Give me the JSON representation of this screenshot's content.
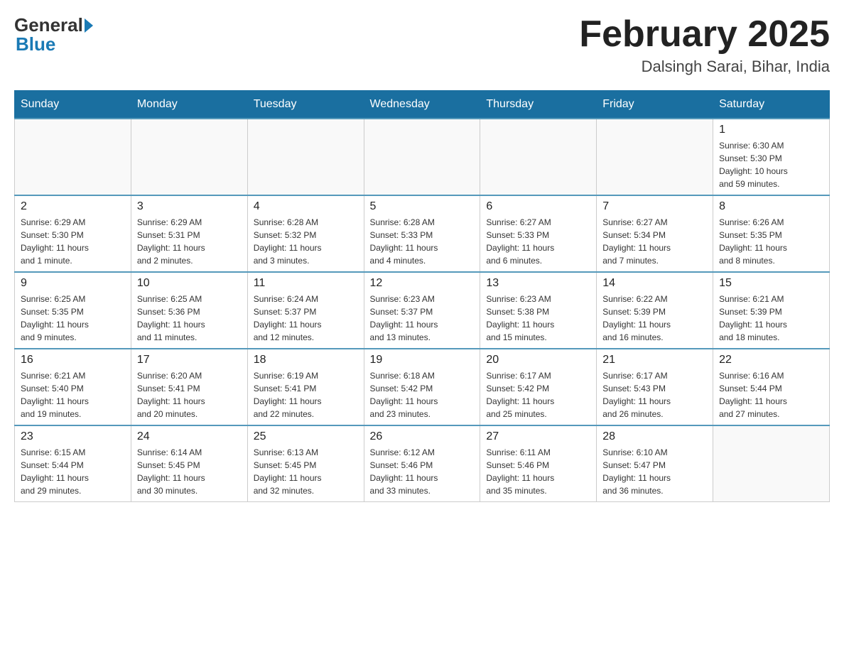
{
  "header": {
    "logo_general": "General",
    "logo_blue": "Blue",
    "month_title": "February 2025",
    "location": "Dalsingh Sarai, Bihar, India"
  },
  "weekdays": [
    "Sunday",
    "Monday",
    "Tuesday",
    "Wednesday",
    "Thursday",
    "Friday",
    "Saturday"
  ],
  "weeks": [
    [
      {
        "day": "",
        "info": ""
      },
      {
        "day": "",
        "info": ""
      },
      {
        "day": "",
        "info": ""
      },
      {
        "day": "",
        "info": ""
      },
      {
        "day": "",
        "info": ""
      },
      {
        "day": "",
        "info": ""
      },
      {
        "day": "1",
        "info": "Sunrise: 6:30 AM\nSunset: 5:30 PM\nDaylight: 10 hours\nand 59 minutes."
      }
    ],
    [
      {
        "day": "2",
        "info": "Sunrise: 6:29 AM\nSunset: 5:30 PM\nDaylight: 11 hours\nand 1 minute."
      },
      {
        "day": "3",
        "info": "Sunrise: 6:29 AM\nSunset: 5:31 PM\nDaylight: 11 hours\nand 2 minutes."
      },
      {
        "day": "4",
        "info": "Sunrise: 6:28 AM\nSunset: 5:32 PM\nDaylight: 11 hours\nand 3 minutes."
      },
      {
        "day": "5",
        "info": "Sunrise: 6:28 AM\nSunset: 5:33 PM\nDaylight: 11 hours\nand 4 minutes."
      },
      {
        "day": "6",
        "info": "Sunrise: 6:27 AM\nSunset: 5:33 PM\nDaylight: 11 hours\nand 6 minutes."
      },
      {
        "day": "7",
        "info": "Sunrise: 6:27 AM\nSunset: 5:34 PM\nDaylight: 11 hours\nand 7 minutes."
      },
      {
        "day": "8",
        "info": "Sunrise: 6:26 AM\nSunset: 5:35 PM\nDaylight: 11 hours\nand 8 minutes."
      }
    ],
    [
      {
        "day": "9",
        "info": "Sunrise: 6:25 AM\nSunset: 5:35 PM\nDaylight: 11 hours\nand 9 minutes."
      },
      {
        "day": "10",
        "info": "Sunrise: 6:25 AM\nSunset: 5:36 PM\nDaylight: 11 hours\nand 11 minutes."
      },
      {
        "day": "11",
        "info": "Sunrise: 6:24 AM\nSunset: 5:37 PM\nDaylight: 11 hours\nand 12 minutes."
      },
      {
        "day": "12",
        "info": "Sunrise: 6:23 AM\nSunset: 5:37 PM\nDaylight: 11 hours\nand 13 minutes."
      },
      {
        "day": "13",
        "info": "Sunrise: 6:23 AM\nSunset: 5:38 PM\nDaylight: 11 hours\nand 15 minutes."
      },
      {
        "day": "14",
        "info": "Sunrise: 6:22 AM\nSunset: 5:39 PM\nDaylight: 11 hours\nand 16 minutes."
      },
      {
        "day": "15",
        "info": "Sunrise: 6:21 AM\nSunset: 5:39 PM\nDaylight: 11 hours\nand 18 minutes."
      }
    ],
    [
      {
        "day": "16",
        "info": "Sunrise: 6:21 AM\nSunset: 5:40 PM\nDaylight: 11 hours\nand 19 minutes."
      },
      {
        "day": "17",
        "info": "Sunrise: 6:20 AM\nSunset: 5:41 PM\nDaylight: 11 hours\nand 20 minutes."
      },
      {
        "day": "18",
        "info": "Sunrise: 6:19 AM\nSunset: 5:41 PM\nDaylight: 11 hours\nand 22 minutes."
      },
      {
        "day": "19",
        "info": "Sunrise: 6:18 AM\nSunset: 5:42 PM\nDaylight: 11 hours\nand 23 minutes."
      },
      {
        "day": "20",
        "info": "Sunrise: 6:17 AM\nSunset: 5:42 PM\nDaylight: 11 hours\nand 25 minutes."
      },
      {
        "day": "21",
        "info": "Sunrise: 6:17 AM\nSunset: 5:43 PM\nDaylight: 11 hours\nand 26 minutes."
      },
      {
        "day": "22",
        "info": "Sunrise: 6:16 AM\nSunset: 5:44 PM\nDaylight: 11 hours\nand 27 minutes."
      }
    ],
    [
      {
        "day": "23",
        "info": "Sunrise: 6:15 AM\nSunset: 5:44 PM\nDaylight: 11 hours\nand 29 minutes."
      },
      {
        "day": "24",
        "info": "Sunrise: 6:14 AM\nSunset: 5:45 PM\nDaylight: 11 hours\nand 30 minutes."
      },
      {
        "day": "25",
        "info": "Sunrise: 6:13 AM\nSunset: 5:45 PM\nDaylight: 11 hours\nand 32 minutes."
      },
      {
        "day": "26",
        "info": "Sunrise: 6:12 AM\nSunset: 5:46 PM\nDaylight: 11 hours\nand 33 minutes."
      },
      {
        "day": "27",
        "info": "Sunrise: 6:11 AM\nSunset: 5:46 PM\nDaylight: 11 hours\nand 35 minutes."
      },
      {
        "day": "28",
        "info": "Sunrise: 6:10 AM\nSunset: 5:47 PM\nDaylight: 11 hours\nand 36 minutes."
      },
      {
        "day": "",
        "info": ""
      }
    ]
  ]
}
